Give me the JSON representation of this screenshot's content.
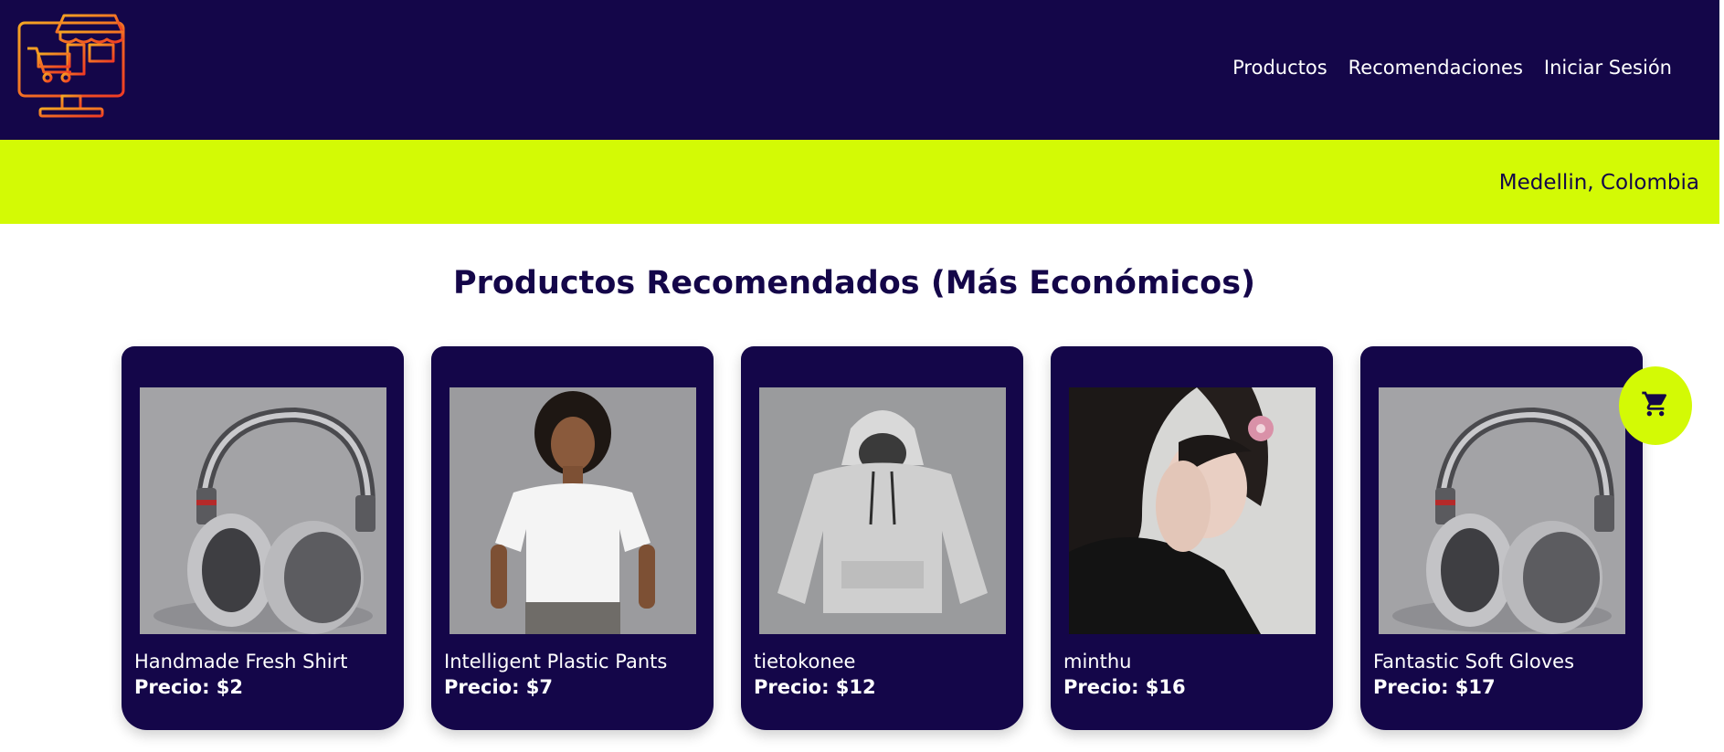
{
  "header": {
    "logo_icon": "store-computer-cart-icon",
    "nav": [
      {
        "label": "Productos"
      },
      {
        "label": "Recomendaciones"
      },
      {
        "label": "Iniciar Sesión"
      }
    ]
  },
  "banner": {
    "location": "Medellin, Colombia"
  },
  "main": {
    "title": "Productos Recomendados (Más Económicos)",
    "products": [
      {
        "name": "Handmade Fresh Shirt",
        "price": "Precio: $2",
        "image": "headphones"
      },
      {
        "name": "Intelligent Plastic Pants",
        "price": "Precio: $7",
        "image": "woman-white-tshirt"
      },
      {
        "name": "tietokonee",
        "price": "Precio: $12",
        "image": "grey-hoodie"
      },
      {
        "name": "minthu",
        "price": "Precio: $16",
        "image": "woman-with-flower"
      },
      {
        "name": "Fantastic Soft Gloves",
        "price": "Precio: $17",
        "image": "headphones"
      }
    ]
  },
  "cart_button": {
    "icon": "shopping-cart-icon"
  },
  "colors": {
    "navy": "#140649",
    "lime": "#d3fa05",
    "white": "#ffffff"
  }
}
